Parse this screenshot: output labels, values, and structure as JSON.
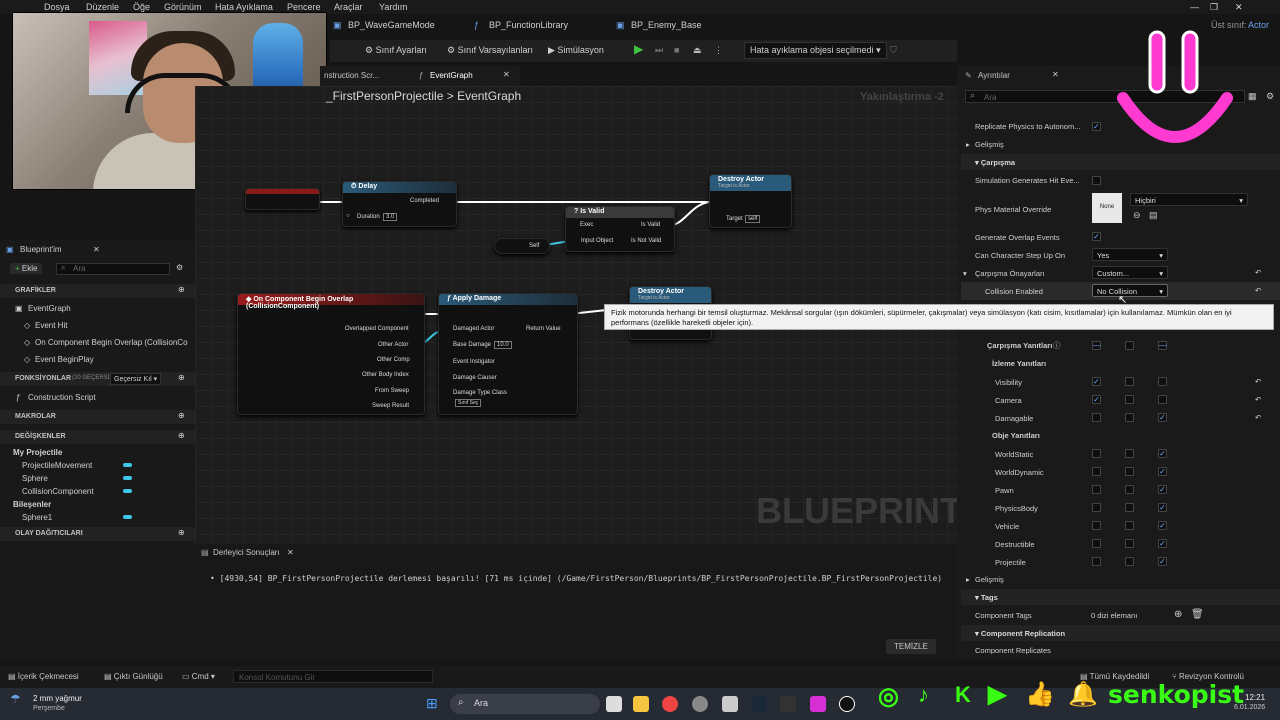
{
  "menu": [
    "Dosya",
    "Düzenle",
    "Öğe",
    "Görünüm",
    "Hata Ayıklama",
    "Pencere",
    "Araçlar",
    "Yardım"
  ],
  "tabs": [
    "BP_WaveGameMode",
    "BP_FunctionLibrary",
    "BP_Enemy_Base"
  ],
  "parent_class_label": "Üst sınıf:",
  "parent_class_value": "Actor",
  "toolbar": {
    "class_settings": "Sınıf Ayarları",
    "class_defaults": "Sınıf Varsayılanları",
    "simulation": "Simülasyon",
    "debug_object": "Hata ayıklama objesi seçilmedi"
  },
  "graph_tabs": {
    "construction": "nstruction Scr...",
    "event_graph": "EventGraph"
  },
  "breadcrumb": {
    "class": "_FirstPersonProjectile",
    "sep": ">",
    "graph": "EventGraph"
  },
  "zoom": "Yakınlaştırma -2",
  "watermark": "BLUEPRINT",
  "my_blueprint": {
    "title": "Blueprint'im",
    "add": "Ekle",
    "search_placeholder": "Ara",
    "graphs_header": "GRAFİKLER",
    "event_graph": "EventGraph",
    "events": [
      "Event Hit",
      "On Component Begin Overlap (CollisionCo",
      "Event BeginPlay"
    ],
    "functions_header": "FONKSİYONLAR",
    "functions_count": "(20 GEÇERSİZ",
    "override": "Geçersiz Kıl",
    "construction": "Construction Script",
    "macros": "MAKROLAR",
    "variables": "DEĞİŞKENLER",
    "my_projectile": "My Projectile",
    "vars": [
      "ProjectileMovement",
      "Sphere",
      "CollisionComponent"
    ],
    "components_header": "Bileşenler",
    "components": [
      "Sphere1"
    ],
    "dispatchers": "OLAY DAĞITICILARI"
  },
  "nodes": {
    "delay": {
      "title": "Delay",
      "completed": "Completed",
      "duration": "Duration",
      "duration_value": "3.0"
    },
    "is_valid": {
      "title": "? Is Valid",
      "exec": "Exec",
      "input_object": "Input Object",
      "valid": "Is Valid",
      "not_valid": "Is Not Valid"
    },
    "self": "Self",
    "destroy1": {
      "title": "Destroy Actor",
      "subtitle": "Target is Actor",
      "target": "Target",
      "self": "self"
    },
    "destroy2": {
      "title": "Destroy Actor",
      "subtitle": "Target is Actor"
    },
    "overlap": {
      "title": "On Component Begin Overlap (CollisionComponent)",
      "pins": [
        "Overlapped Component",
        "Other Actor",
        "Other Comp",
        "Other Body Index",
        "From Sweep",
        "Sweep Result"
      ]
    },
    "apply_damage": {
      "title": "Apply Damage",
      "damaged": "Damaged Actor",
      "base_damage": "Base Damage",
      "base_value": "10.0",
      "instigator": "Event Instigator",
      "causer": "Damage Causer",
      "type_class": "Damage Type Class",
      "type_select": "Sınıf Seç",
      "return": "Return Value"
    }
  },
  "details": {
    "title": "Ayrıntılar",
    "search_placeholder": "Ara",
    "replicate_label": "Replicate Physics to Autonom...",
    "advanced": "Gelişmiş",
    "collision_section": "Çarpışma",
    "sim_hit": "Simulation Generates Hit Eve...",
    "phys_material": "Phys Material Override",
    "phys_none": "None",
    "phys_value": "Hiçbiri",
    "overlap_events": "Generate Overlap Events",
    "step_up": "Can Character Step Up On",
    "step_up_value": "Yes",
    "presets": "Çarpışma Önayarları",
    "presets_value": "Custom...",
    "enabled": "Collision Enabled",
    "enabled_value": "No Collision",
    "responses": "Çarpışma Yanıtları",
    "trace_responses": "İzleme Yanıtları",
    "trace": [
      "Visibility",
      "Camera",
      "Damagable"
    ],
    "object_responses": "Obje Yanıtları",
    "objects": [
      "WorldStatic",
      "WorldDynamic",
      "Pawn",
      "PhysicsBody",
      "Vehicle",
      "Destructible",
      "Projectile"
    ],
    "advanced2": "Gelişmiş",
    "tags_section": "Tags",
    "component_tags": "Component Tags",
    "tags_value": "0 dizi elemanı",
    "replication_section": "Component Replication",
    "replication_row": "Component Replicates"
  },
  "tooltip": "Fizik motorunda herhangi bir temsil oluşturmaz. Mekânsal sorgular (ışın dökümleri, süpürmeler, çakışmalar) veya simülasyon (katı cisim, kısıtlamalar) için kullanılamaz. Mümkün olan en iyi performans (özellikle hareketli objeler için).",
  "compiler": {
    "title": "Derleyici Sonuçları",
    "message": "[4930,54] BP_FirstPersonProjectile derlemesi başarılı! [71 ms içinde] (/Game/FirstPerson/Blueprints/BP_FirstPersonProjectile.BP_FirstPersonProjectile)",
    "clear": "TEMİZLE"
  },
  "statusbar": {
    "content_drawer": "İçerik Çekmecesi",
    "output_log": "Çıktı Günlüğü",
    "cmd": "Cmd",
    "console_placeholder": "Konsol Komutunu Gir",
    "save_all": "Tümü Kaydedildi",
    "revision": "Revizyon Kontrolü"
  },
  "taskbar": {
    "weather": "2 mm yağmur",
    "day": "Perşembe",
    "search": "Ara",
    "time": "12:21",
    "date": "6.01.2026"
  },
  "stream": {
    "handle": "senkopist",
    "accent": "#39ff14",
    "smile_color": "#ff3ad0"
  }
}
